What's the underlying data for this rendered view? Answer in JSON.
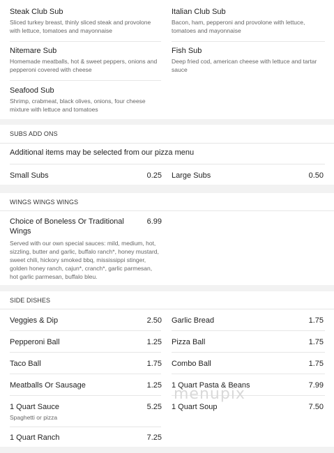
{
  "subs_top": [
    {
      "name": "Steak Club Sub",
      "desc": "Sliced turkey breast, thinly sliced steak and provolone with lettuce, tomatoes and mayonnaise"
    },
    {
      "name": "Italian Club Sub",
      "desc": "Bacon, ham, pepperoni and provolone with lettuce, tomatoes and mayonnaise"
    },
    {
      "name": "Nitemare Sub",
      "desc": "Homemade meatballs, hot & sweet peppers, onions and pepperoni covered with cheese"
    },
    {
      "name": "Fish Sub",
      "desc": "Deep fried cod, american cheese with lettuce and tartar sauce"
    },
    {
      "name": "Seafood Sub",
      "desc": "Shrimp, crabmeat, black olives, onions, four cheese mixture with lettuce and tomatoes"
    }
  ],
  "subs_add_ons": {
    "title": "SUBS ADD ONS",
    "note": "Additional items may be selected from our pizza menu",
    "items": [
      {
        "name": "Small Subs",
        "price": "0.25"
      },
      {
        "name": "Large Subs",
        "price": "0.50"
      }
    ]
  },
  "wings": {
    "title": "WINGS WINGS WINGS",
    "item": {
      "name": "Choice of Boneless Or Traditional Wings",
      "price": "6.99",
      "desc": "Served with our own special sauces: mild, medium, hot, sizzling, butter and garlic, buffalo ranch*, honey mustard, sweet chili, hickory smoked bbq, mississippi stinger, golden honey ranch, cajun*, cranch*, garlic parmesan, hot garlic parmesan, buffalo bleu."
    }
  },
  "side_dishes": {
    "title": "SIDE DISHES",
    "items": [
      {
        "name": "Veggies & Dip",
        "price": "2.50"
      },
      {
        "name": "Garlic Bread",
        "price": "1.75"
      },
      {
        "name": "Pepperoni Ball",
        "price": "1.25"
      },
      {
        "name": "Pizza Ball",
        "price": "1.75"
      },
      {
        "name": "Taco Ball",
        "price": "1.75"
      },
      {
        "name": "Combo Ball",
        "price": "1.75"
      },
      {
        "name": "Meatballs Or Sausage",
        "price": "1.25"
      },
      {
        "name": "1 Quart Pasta & Beans",
        "price": "7.99"
      },
      {
        "name": "1 Quart Sauce",
        "price": "5.25",
        "desc": "Spaghetti or pizza"
      },
      {
        "name": "1 Quart Soup",
        "price": "7.50"
      },
      {
        "name": "1 Quart Ranch",
        "price": "7.25"
      }
    ]
  },
  "watermark": "menupix"
}
